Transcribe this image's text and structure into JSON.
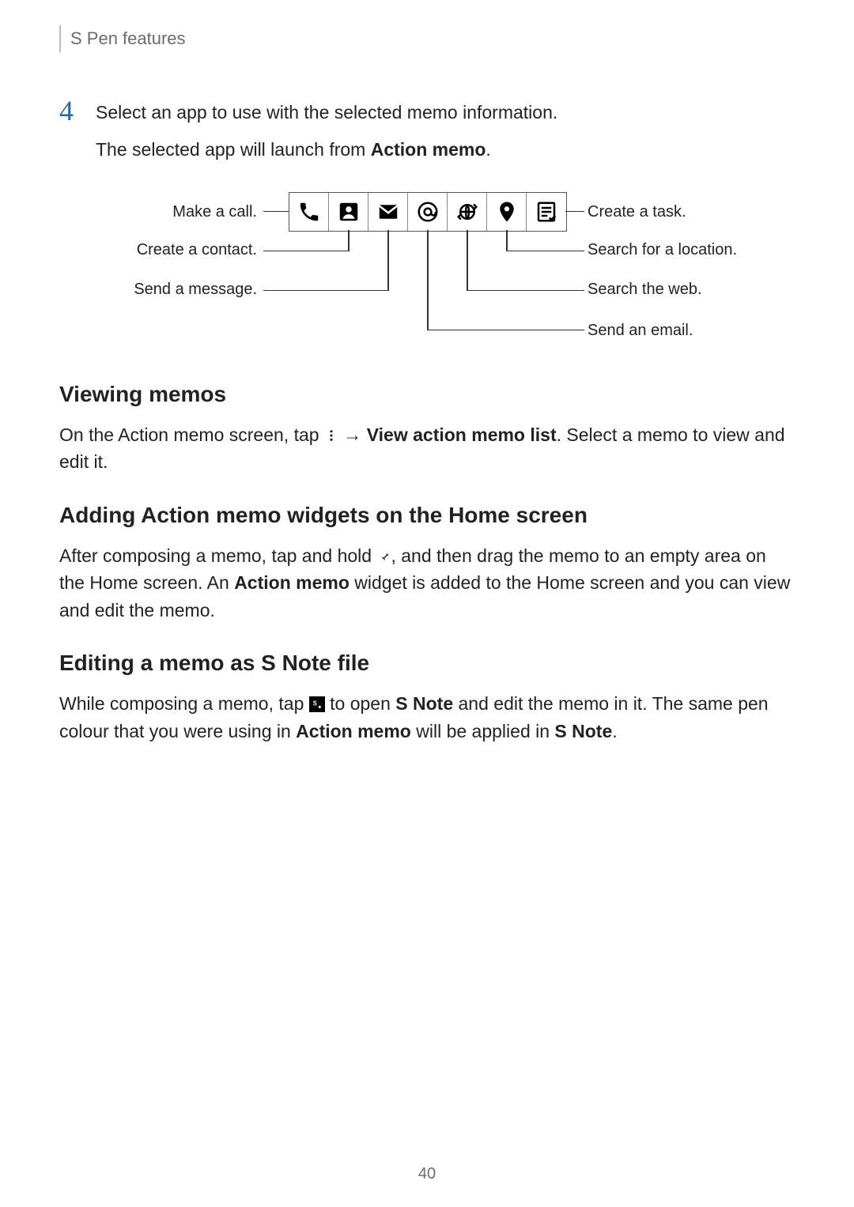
{
  "header": {
    "section_label": "S Pen features"
  },
  "step": {
    "number": "4",
    "line1": "Select an app to use with the selected memo information.",
    "line2_a": "The selected app will launch from ",
    "line2_bold": "Action memo",
    "line2_b": "."
  },
  "diagram": {
    "labels": {
      "make_call": "Make a call.",
      "create_contact": "Create a contact.",
      "send_message": "Send a message.",
      "create_task": "Create a task.",
      "search_location": "Search for a location.",
      "search_web": "Search the web.",
      "send_email": "Send an email."
    },
    "icons": {
      "phone": "phone-icon",
      "contact": "contact-icon",
      "message": "message-icon",
      "email_at": "at-icon",
      "web": "globe-arrows-icon",
      "location": "location-pin-icon",
      "task": "task-list-icon"
    }
  },
  "sections": {
    "viewing": {
      "heading": "Viewing memos",
      "p_a": "On the Action memo screen, tap ",
      "p_arrow": " → ",
      "p_bold": "View action memo list",
      "p_b": ". Select a memo to view and edit it."
    },
    "adding": {
      "heading": "Adding Action memo widgets on the Home screen",
      "p_a": "After composing a memo, tap and hold ",
      "p_b": ", and then drag the memo to an empty area on the Home screen. An ",
      "p_bold1": "Action memo",
      "p_c": " widget is added to the Home screen and you can view and edit the memo."
    },
    "editing": {
      "heading": "Editing a memo as S Note file",
      "p_a": "While composing a memo, tap ",
      "p_b": " to open ",
      "p_bold1": "S Note",
      "p_c": " and edit the memo in it. The same pen colour that you were using in ",
      "p_bold2": "Action memo",
      "p_d": " will be applied in ",
      "p_bold3": "S Note",
      "p_e": "."
    }
  },
  "page_number": "40"
}
